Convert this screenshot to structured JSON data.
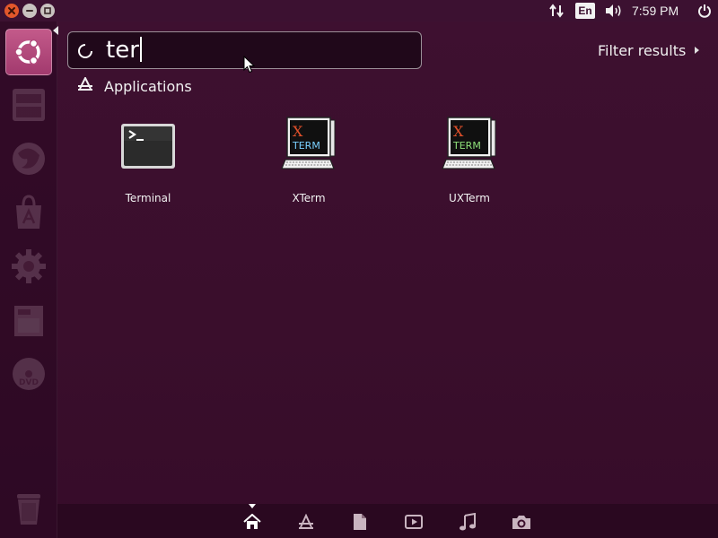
{
  "top_panel": {
    "window_controls": {
      "close_icon": "close-icon",
      "minimize_icon": "minimize-icon",
      "maximize_icon": "maximize-icon",
      "close_color": "#e2572b"
    },
    "indicators": {
      "network_icon": "network-updown-icon",
      "keyboard_language": "En",
      "sound_icon": "speaker-icon",
      "clock": "7:59 PM",
      "power_icon": "power-gear-icon"
    }
  },
  "launcher": {
    "items": [
      {
        "name": "Dash Home",
        "icon": "ubuntu-logo-icon",
        "active": true
      },
      {
        "name": "Files",
        "icon": "file-cabinet-icon"
      },
      {
        "name": "Firefox",
        "icon": "firefox-icon"
      },
      {
        "name": "Software Center",
        "icon": "software-center-icon"
      },
      {
        "name": "System Settings",
        "icon": "settings-gear-icon"
      },
      {
        "name": "Writer",
        "icon": "document-writer-icon"
      },
      {
        "name": "DVD",
        "icon": "dvd-icon"
      },
      {
        "name": "Trash",
        "icon": "trash-icon"
      }
    ],
    "accent_color": "#b84a7c"
  },
  "search": {
    "query": "ter",
    "spinner_icon": "loading-spinner-icon"
  },
  "filter": {
    "label": "Filter results"
  },
  "results": {
    "category": {
      "label": "Applications",
      "icon": "applications-lens-icon"
    },
    "apps": [
      {
        "label": "Terminal",
        "icon": "terminal-icon"
      },
      {
        "label": "XTerm",
        "icon": "xterm-icon"
      },
      {
        "label": "UXTerm",
        "icon": "uxterm-icon"
      }
    ]
  },
  "xterm_icon_text": {
    "x": "X",
    "term": "TERM"
  },
  "lenses": [
    {
      "name": "Home",
      "icon": "home-icon",
      "active": true
    },
    {
      "name": "Applications",
      "icon": "applications-lens-icon"
    },
    {
      "name": "Files",
      "icon": "file-icon"
    },
    {
      "name": "Video",
      "icon": "video-icon"
    },
    {
      "name": "Music",
      "icon": "music-note-icon"
    },
    {
      "name": "Photos",
      "icon": "camera-icon"
    }
  ],
  "colors": {
    "background": "#3e1030",
    "panel": "#3c1131",
    "text": "#ffffff"
  }
}
